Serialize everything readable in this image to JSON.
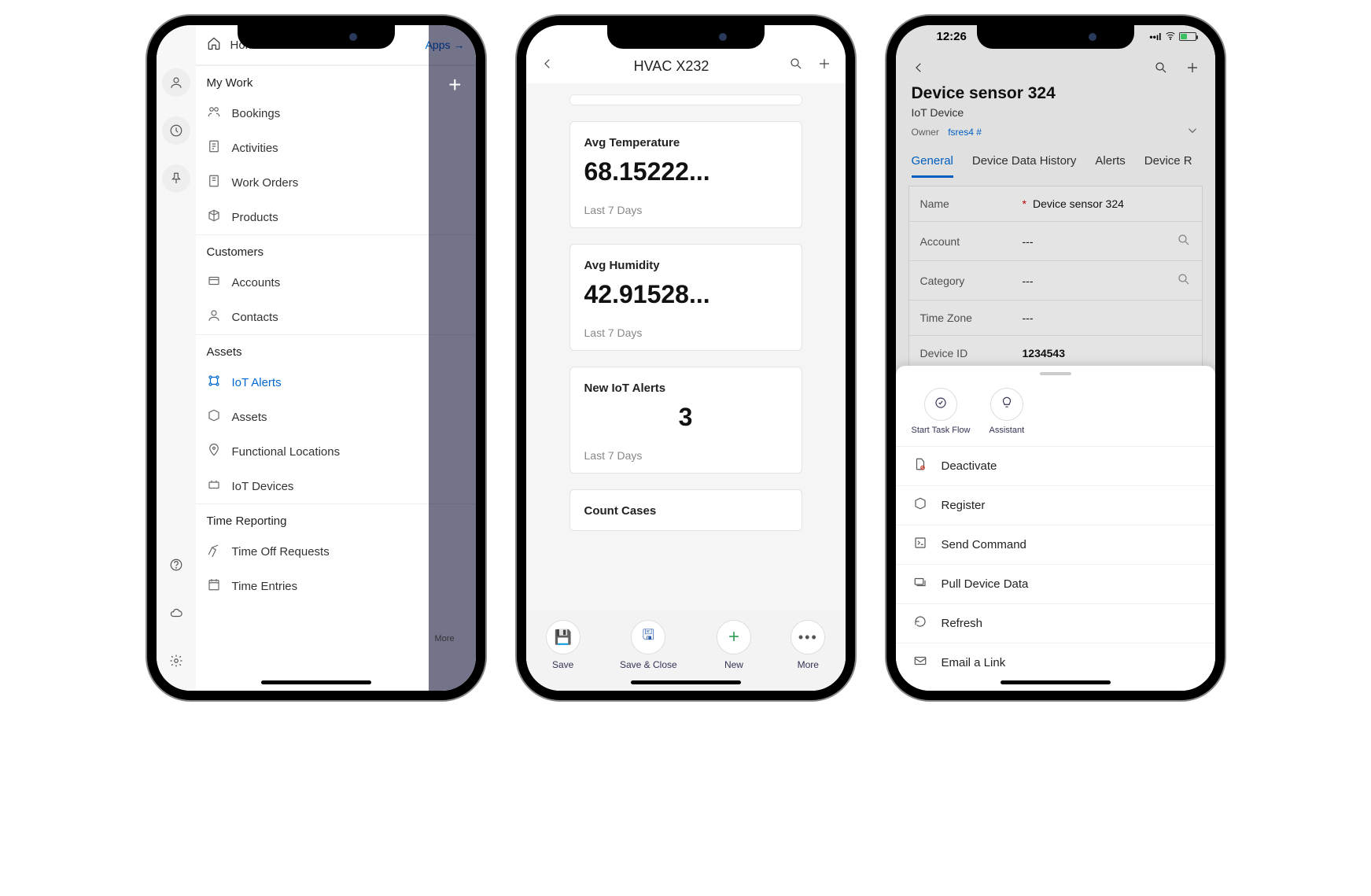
{
  "phone1": {
    "home_label": "Home",
    "apps_label": "Apps",
    "sections": {
      "mywork": "My Work",
      "customers": "Customers",
      "assets": "Assets",
      "timereporting": "Time Reporting"
    },
    "items": {
      "bookings": "Bookings",
      "activities": "Activities",
      "workorders": "Work Orders",
      "products": "Products",
      "accounts": "Accounts",
      "contacts": "Contacts",
      "iotalerts": "IoT Alerts",
      "assets": "Assets",
      "funclocations": "Functional Locations",
      "iotdevices": "IoT Devices",
      "timeoff": "Time Off Requests",
      "timeentries": "Time Entries"
    },
    "more": "More"
  },
  "phone2": {
    "title": "HVAC X232",
    "cards": {
      "temp": {
        "title": "Avg Temperature",
        "value": "68.15222...",
        "sub": "Last 7 Days"
      },
      "humidity": {
        "title": "Avg Humidity",
        "value": "42.91528...",
        "sub": "Last 7 Days"
      },
      "alerts": {
        "title": "New IoT Alerts",
        "value": "3",
        "sub": "Last 7 Days"
      },
      "cases": {
        "title": "Count Cases"
      }
    },
    "bottom": {
      "save": "Save",
      "saveclose": "Save & Close",
      "new": "New",
      "more": "More"
    }
  },
  "phone3": {
    "status_time": "12:26",
    "title": "Device sensor 324",
    "subtitle": "IoT Device",
    "owner_label": "Owner",
    "owner_value": "fsres4 #",
    "tabs": {
      "general": "General",
      "history": "Device Data History",
      "alerts": "Alerts",
      "devicer": "Device R"
    },
    "fields": {
      "name": {
        "label": "Name",
        "value": "Device sensor 324"
      },
      "account": {
        "label": "Account",
        "value": "---"
      },
      "category": {
        "label": "Category",
        "value": "---"
      },
      "timezone": {
        "label": "Time Zone",
        "value": "---"
      },
      "deviceid": {
        "label": "Device ID",
        "value": "1234543"
      }
    },
    "sheet": {
      "taskflow": "Start Task Flow",
      "assistant": "Assistant",
      "deactivate": "Deactivate",
      "register": "Register",
      "sendcmd": "Send Command",
      "pull": "Pull Device Data",
      "refresh": "Refresh",
      "email": "Email a Link"
    }
  }
}
